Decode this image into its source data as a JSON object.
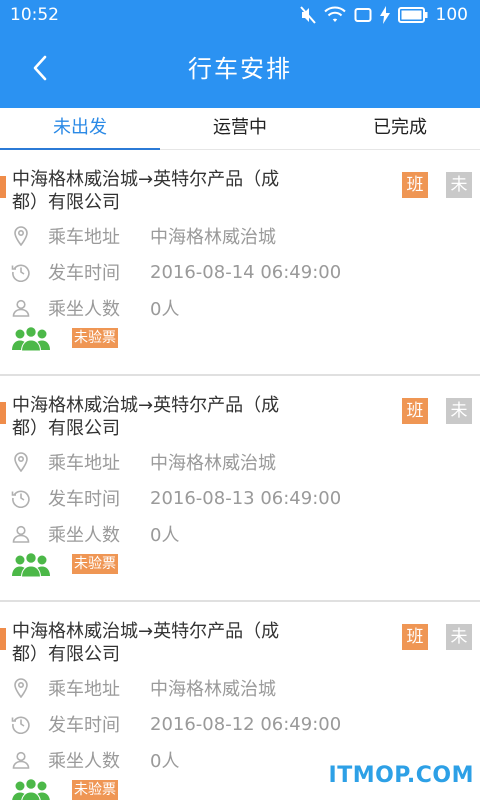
{
  "status_bar": {
    "time": "10:52",
    "battery_level": "100",
    "icons": [
      "mute-icon",
      "wifi-icon",
      "screen-icon",
      "charging-icon",
      "battery-icon"
    ]
  },
  "header": {
    "title": "行车安排",
    "back_icon": "chevron-left-icon"
  },
  "tabs": [
    {
      "label": "未出发",
      "active": true
    },
    {
      "label": "运营中",
      "active": false
    },
    {
      "label": "已完成",
      "active": false
    }
  ],
  "trips": [
    {
      "route": "中海格林威治城→英特尔产品（成都）有限公司",
      "shift_badge": "班",
      "status_badge": "未",
      "address_label": "乘车地址",
      "address": "中海格林威治城",
      "time_label": "发车时间",
      "departure_time": "2016-08-14 06:49:00",
      "passengers_label": "乘坐人数",
      "passengers": "0人",
      "ticket_status": "未验票"
    },
    {
      "route": "中海格林威治城→英特尔产品（成都）有限公司",
      "shift_badge": "班",
      "status_badge": "未",
      "address_label": "乘车地址",
      "address": "中海格林威治城",
      "time_label": "发车时间",
      "departure_time": "2016-08-13 06:49:00",
      "passengers_label": "乘坐人数",
      "passengers": "0人",
      "ticket_status": "未验票"
    },
    {
      "route": "中海格林威治城→英特尔产品（成都）有限公司",
      "shift_badge": "班",
      "status_badge": "未",
      "address_label": "乘车地址",
      "address": "中海格林威治城",
      "time_label": "发车时间",
      "departure_time": "2016-08-12 06:49:00",
      "passengers_label": "乘坐人数",
      "passengers": "0人",
      "ticket_status": "未验票"
    }
  ],
  "watermark": "ITMOP.COM",
  "colors": {
    "header": "#2b92f2",
    "active_tab": "#2b8ae6",
    "accent_orange": "#ef9654",
    "badge_gray": "#c9c9c9",
    "group_icon_green": "#4cb848",
    "watermark": "#2da0e6"
  }
}
